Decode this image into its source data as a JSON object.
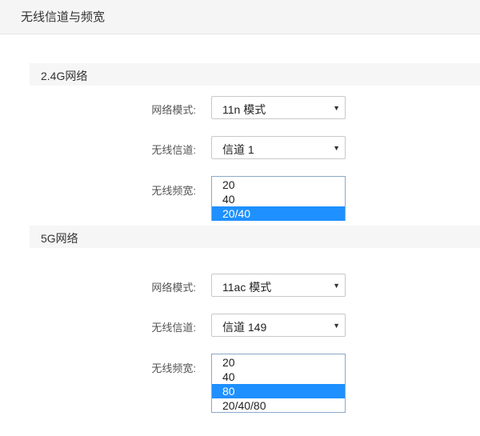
{
  "header": {
    "title": "无线信道与频宽"
  },
  "sections": [
    {
      "title": "2.4G网络",
      "mode_label": "网络模式:",
      "mode_value": "11n 模式",
      "channel_label": "无线信道:",
      "channel_value": "信道 1",
      "bandwidth_label": "无线频宽:",
      "bandwidth_options": [
        "20",
        "40",
        "20/40"
      ],
      "bandwidth_selected": "20/40"
    },
    {
      "title": "5G网络",
      "mode_label": "网络模式:",
      "mode_value": "11ac 模式",
      "channel_label": "无线信道:",
      "channel_value": "信道 149",
      "bandwidth_label": "无线频宽:",
      "bandwidth_options": [
        "20",
        "40",
        "80",
        "20/40/80"
      ],
      "bandwidth_selected": "80"
    }
  ],
  "icons": {
    "dropdown_arrow": "▼"
  },
  "colors": {
    "selection": "#1e90ff"
  }
}
